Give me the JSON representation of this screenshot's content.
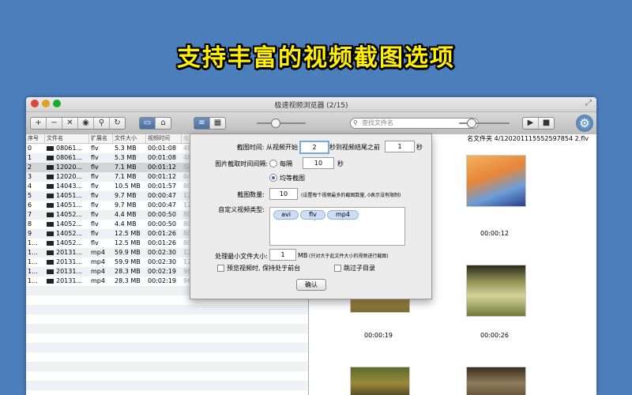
{
  "banner": "支持丰富的视频截图选项",
  "window": {
    "title": "极速视频浏览器 (2/15)"
  },
  "toolbar": {
    "add": "+",
    "remove": "−",
    "close": "✕",
    "view": "◉",
    "search_btn": "⚲",
    "refresh": "↻",
    "search_placeholder": "查找文件名",
    "play": "▶",
    "stop": "■"
  },
  "table": {
    "headers": [
      "序号",
      "文件名",
      "扩展名",
      "文件大小",
      "视频时间",
      "视"
    ],
    "rows": [
      [
        "0",
        "08061...",
        "flv",
        "5.3 MB",
        "00:01:08",
        "48"
      ],
      [
        "1",
        "08061...",
        "flv",
        "5.3 MB",
        "00:01:08",
        "48"
      ],
      [
        "2",
        "12020...",
        "flv",
        "7.1 MB",
        "00:01:12",
        "64"
      ],
      [
        "3",
        "12020...",
        "flv",
        "7.1 MB",
        "00:01:12",
        "64"
      ],
      [
        "4",
        "14043...",
        "flv",
        "10.5 MB",
        "00:01:57",
        "80"
      ],
      [
        "5",
        "14051...",
        "flv",
        "9.7 MB",
        "00:00:47",
        "12"
      ],
      [
        "6",
        "14051...",
        "flv",
        "9.7 MB",
        "00:00:47",
        "12"
      ],
      [
        "7",
        "14052...",
        "flv",
        "4.4 MB",
        "00:00:50",
        "80"
      ],
      [
        "8",
        "14052...",
        "flv",
        "4.4 MB",
        "00:00:50",
        "80"
      ],
      [
        "9",
        "14052...",
        "flv",
        "12.5 MB",
        "00:01:26",
        "80"
      ],
      [
        "1...",
        "14052...",
        "flv",
        "12.5 MB",
        "00:01:26",
        "80"
      ],
      [
        "1...",
        "20131...",
        "mp4",
        "59.9 MB",
        "00:02:30",
        "12"
      ],
      [
        "1...",
        "20131...",
        "mp4",
        "59.9 MB",
        "00:02:30",
        "12"
      ],
      [
        "1...",
        "20131...",
        "mp4",
        "28.3 MB",
        "00:02:19",
        "96"
      ],
      [
        "1...",
        "20131...",
        "mp4",
        "28.3 MB",
        "00:02:19",
        "96"
      ]
    ]
  },
  "preview": {
    "path": "名文件夹 4/120201115552597854 2.flv",
    "times": [
      "00:00:12",
      "00:00:19",
      "00:00:26"
    ]
  },
  "dialog": {
    "capture_time_label": "截图时间: 从视频开始",
    "start_value": "2",
    "to_end_label": "秒到视频结尾之前",
    "end_value": "1",
    "sec": "秒",
    "interval_label": "图片截取时间间隔:",
    "every_label": "每隔",
    "every_value": "10",
    "even_label": "均等截图",
    "count_label": "截图数量:",
    "count_value": "10",
    "count_hint": "(设置每个视频最多的截图数量, 0表示没有限制)",
    "types_label": "自定义视频类型:",
    "types": [
      "avi",
      "flv",
      "mp4"
    ],
    "min_size_label": "处理最小文件大小:",
    "min_size_value": "1",
    "mb": "MB",
    "min_size_hint": "(只对大于此文件大小的视频进行截图)",
    "preview_front_label": "预览视频时, 保持处于前台",
    "skip_sub_label": "跳过子目录",
    "ok": "确认"
  }
}
